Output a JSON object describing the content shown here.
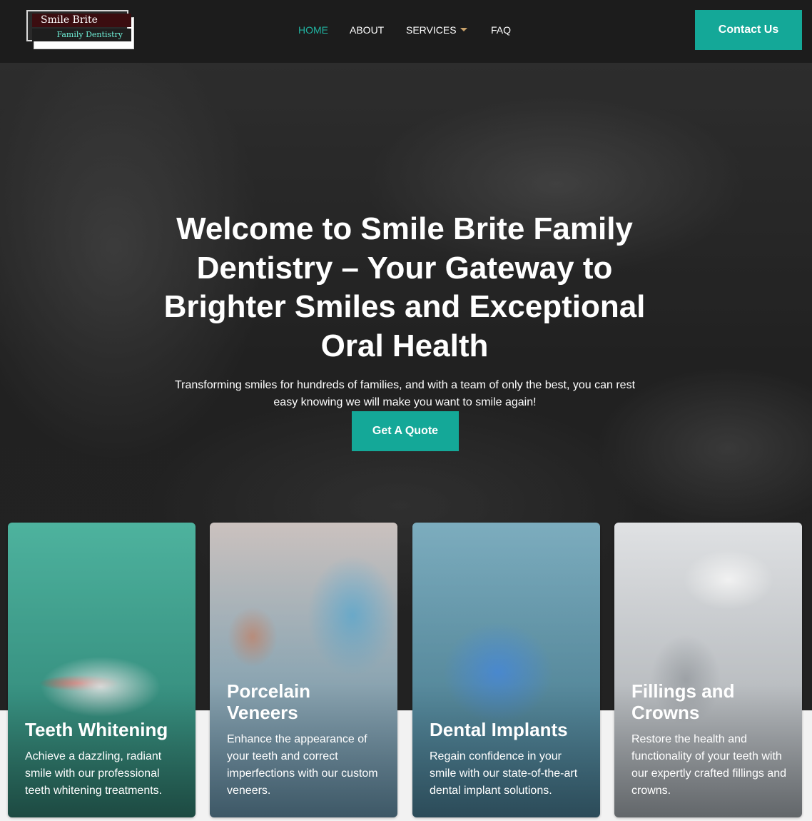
{
  "header": {
    "logo": {
      "line1": "Smile Brite",
      "line2": "Family Dentistry"
    },
    "nav": [
      {
        "label": "HOME",
        "active": true
      },
      {
        "label": "ABOUT",
        "active": false
      },
      {
        "label": "SERVICES",
        "active": false,
        "has_dropdown": true
      },
      {
        "label": "FAQ",
        "active": false
      }
    ],
    "contact_label": "Contact Us"
  },
  "hero": {
    "title": "Welcome to Smile Brite Family Dentistry – Your Gateway to Brighter Smiles and Exceptional Oral Health",
    "subtitle": "Transforming smiles for hundreds of families, and with a team of only the best, you can rest easy knowing we will make you want to smile again!",
    "cta_label": "Get A Quote"
  },
  "services": [
    {
      "title": "Teeth Whitening",
      "description": "Achieve a dazzling, radiant smile with our professional teeth whitening treatments."
    },
    {
      "title": "Porcelain Veneers",
      "description": "Enhance the appearance of your teeth and correct imperfections with our custom veneers."
    },
    {
      "title": "Dental Implants",
      "description": "Regain confidence in your smile with our state-of-the-art dental implant solutions."
    },
    {
      "title": "Fillings and Crowns",
      "description": "Restore the health and functionality of your teeth with our expertly crafted fillings and crowns."
    }
  ],
  "colors": {
    "accent": "#14a898",
    "nav_active": "#21b3a1",
    "header_bg": "#1c1c1c"
  }
}
